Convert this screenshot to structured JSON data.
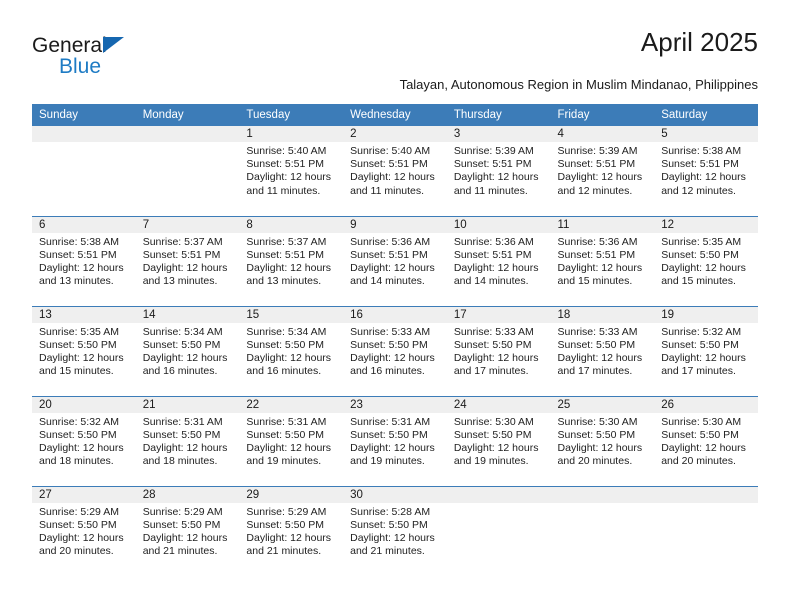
{
  "brand": {
    "name_part1": "General",
    "name_part2": "Blue",
    "triangle_icon": "triangle-icon",
    "color_dark": "#1b1b1b",
    "color_blue": "#1e7bc4"
  },
  "header": {
    "month_title": "April 2025",
    "location": "Talayan, Autonomous Region in Muslim Mindanao, Philippines",
    "accent_color": "#3c7cb8",
    "band_color": "#efefef"
  },
  "weekday_headers": [
    "Sunday",
    "Monday",
    "Tuesday",
    "Wednesday",
    "Thursday",
    "Friday",
    "Saturday"
  ],
  "weeks": [
    [
      {
        "day": "",
        "lines": []
      },
      {
        "day": "",
        "lines": []
      },
      {
        "day": "1",
        "lines": [
          "Sunrise: 5:40 AM",
          "Sunset: 5:51 PM",
          "Daylight: 12 hours",
          "and 11 minutes."
        ]
      },
      {
        "day": "2",
        "lines": [
          "Sunrise: 5:40 AM",
          "Sunset: 5:51 PM",
          "Daylight: 12 hours",
          "and 11 minutes."
        ]
      },
      {
        "day": "3",
        "lines": [
          "Sunrise: 5:39 AM",
          "Sunset: 5:51 PM",
          "Daylight: 12 hours",
          "and 11 minutes."
        ]
      },
      {
        "day": "4",
        "lines": [
          "Sunrise: 5:39 AM",
          "Sunset: 5:51 PM",
          "Daylight: 12 hours",
          "and 12 minutes."
        ]
      },
      {
        "day": "5",
        "lines": [
          "Sunrise: 5:38 AM",
          "Sunset: 5:51 PM",
          "Daylight: 12 hours",
          "and 12 minutes."
        ]
      }
    ],
    [
      {
        "day": "6",
        "lines": [
          "Sunrise: 5:38 AM",
          "Sunset: 5:51 PM",
          "Daylight: 12 hours",
          "and 13 minutes."
        ]
      },
      {
        "day": "7",
        "lines": [
          "Sunrise: 5:37 AM",
          "Sunset: 5:51 PM",
          "Daylight: 12 hours",
          "and 13 minutes."
        ]
      },
      {
        "day": "8",
        "lines": [
          "Sunrise: 5:37 AM",
          "Sunset: 5:51 PM",
          "Daylight: 12 hours",
          "and 13 minutes."
        ]
      },
      {
        "day": "9",
        "lines": [
          "Sunrise: 5:36 AM",
          "Sunset: 5:51 PM",
          "Daylight: 12 hours",
          "and 14 minutes."
        ]
      },
      {
        "day": "10",
        "lines": [
          "Sunrise: 5:36 AM",
          "Sunset: 5:51 PM",
          "Daylight: 12 hours",
          "and 14 minutes."
        ]
      },
      {
        "day": "11",
        "lines": [
          "Sunrise: 5:36 AM",
          "Sunset: 5:51 PM",
          "Daylight: 12 hours",
          "and 15 minutes."
        ]
      },
      {
        "day": "12",
        "lines": [
          "Sunrise: 5:35 AM",
          "Sunset: 5:50 PM",
          "Daylight: 12 hours",
          "and 15 minutes."
        ]
      }
    ],
    [
      {
        "day": "13",
        "lines": [
          "Sunrise: 5:35 AM",
          "Sunset: 5:50 PM",
          "Daylight: 12 hours",
          "and 15 minutes."
        ]
      },
      {
        "day": "14",
        "lines": [
          "Sunrise: 5:34 AM",
          "Sunset: 5:50 PM",
          "Daylight: 12 hours",
          "and 16 minutes."
        ]
      },
      {
        "day": "15",
        "lines": [
          "Sunrise: 5:34 AM",
          "Sunset: 5:50 PM",
          "Daylight: 12 hours",
          "and 16 minutes."
        ]
      },
      {
        "day": "16",
        "lines": [
          "Sunrise: 5:33 AM",
          "Sunset: 5:50 PM",
          "Daylight: 12 hours",
          "and 16 minutes."
        ]
      },
      {
        "day": "17",
        "lines": [
          "Sunrise: 5:33 AM",
          "Sunset: 5:50 PM",
          "Daylight: 12 hours",
          "and 17 minutes."
        ]
      },
      {
        "day": "18",
        "lines": [
          "Sunrise: 5:33 AM",
          "Sunset: 5:50 PM",
          "Daylight: 12 hours",
          "and 17 minutes."
        ]
      },
      {
        "day": "19",
        "lines": [
          "Sunrise: 5:32 AM",
          "Sunset: 5:50 PM",
          "Daylight: 12 hours",
          "and 17 minutes."
        ]
      }
    ],
    [
      {
        "day": "20",
        "lines": [
          "Sunrise: 5:32 AM",
          "Sunset: 5:50 PM",
          "Daylight: 12 hours",
          "and 18 minutes."
        ]
      },
      {
        "day": "21",
        "lines": [
          "Sunrise: 5:31 AM",
          "Sunset: 5:50 PM",
          "Daylight: 12 hours",
          "and 18 minutes."
        ]
      },
      {
        "day": "22",
        "lines": [
          "Sunrise: 5:31 AM",
          "Sunset: 5:50 PM",
          "Daylight: 12 hours",
          "and 19 minutes."
        ]
      },
      {
        "day": "23",
        "lines": [
          "Sunrise: 5:31 AM",
          "Sunset: 5:50 PM",
          "Daylight: 12 hours",
          "and 19 minutes."
        ]
      },
      {
        "day": "24",
        "lines": [
          "Sunrise: 5:30 AM",
          "Sunset: 5:50 PM",
          "Daylight: 12 hours",
          "and 19 minutes."
        ]
      },
      {
        "day": "25",
        "lines": [
          "Sunrise: 5:30 AM",
          "Sunset: 5:50 PM",
          "Daylight: 12 hours",
          "and 20 minutes."
        ]
      },
      {
        "day": "26",
        "lines": [
          "Sunrise: 5:30 AM",
          "Sunset: 5:50 PM",
          "Daylight: 12 hours",
          "and 20 minutes."
        ]
      }
    ],
    [
      {
        "day": "27",
        "lines": [
          "Sunrise: 5:29 AM",
          "Sunset: 5:50 PM",
          "Daylight: 12 hours",
          "and 20 minutes."
        ]
      },
      {
        "day": "28",
        "lines": [
          "Sunrise: 5:29 AM",
          "Sunset: 5:50 PM",
          "Daylight: 12 hours",
          "and 21 minutes."
        ]
      },
      {
        "day": "29",
        "lines": [
          "Sunrise: 5:29 AM",
          "Sunset: 5:50 PM",
          "Daylight: 12 hours",
          "and 21 minutes."
        ]
      },
      {
        "day": "30",
        "lines": [
          "Sunrise: 5:28 AM",
          "Sunset: 5:50 PM",
          "Daylight: 12 hours",
          "and 21 minutes."
        ]
      },
      {
        "day": "",
        "lines": []
      },
      {
        "day": "",
        "lines": []
      },
      {
        "day": "",
        "lines": []
      }
    ]
  ]
}
